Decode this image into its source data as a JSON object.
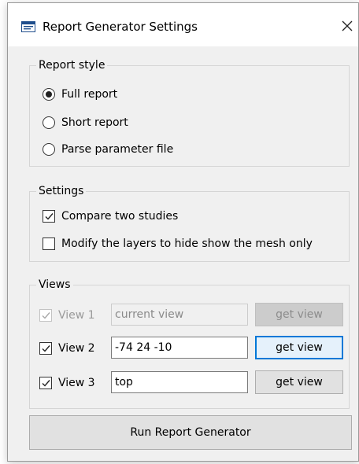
{
  "window": {
    "title": "Report Generator Settings",
    "icon": "report-window-icon",
    "close_icon": "close-icon"
  },
  "report_style": {
    "title": "Report style",
    "options": [
      {
        "label": "Full report",
        "selected": true
      },
      {
        "label": "Short report",
        "selected": false
      },
      {
        "label": "Parse parameter file",
        "selected": false
      }
    ]
  },
  "settings": {
    "title": "Settings",
    "options": [
      {
        "label": "Compare two studies",
        "checked": true
      },
      {
        "label": "Modify the layers to hide show the mesh only",
        "checked": false
      }
    ]
  },
  "views": {
    "title": "Views",
    "rows": [
      {
        "label": "View 1",
        "checked": true,
        "enabled": false,
        "value": "current view",
        "button": "get view"
      },
      {
        "label": "View 2",
        "checked": true,
        "enabled": true,
        "value": "-74 24 -10",
        "button": "get view"
      },
      {
        "label": "View 3",
        "checked": true,
        "enabled": true,
        "value": "top",
        "button": "get view"
      }
    ]
  },
  "run_button": "Run Report Generator",
  "colors": {
    "window_bg": "#f0f0f0",
    "focus_accent": "#0078d7",
    "disabled_text": "#9a9a9a"
  }
}
